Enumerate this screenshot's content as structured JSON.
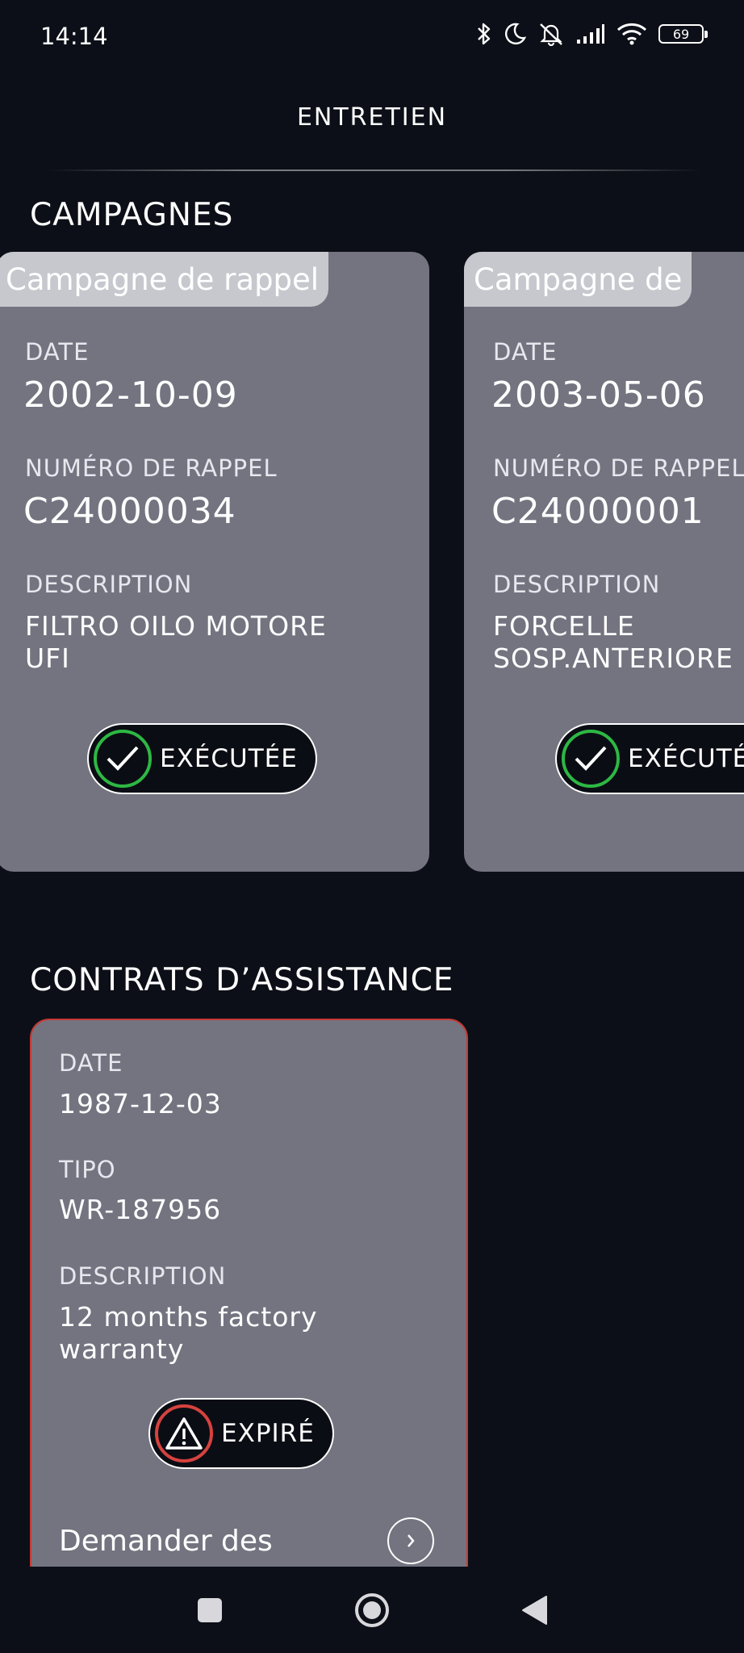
{
  "status_bar": {
    "time": "14:14",
    "battery": "69",
    "icons": [
      "bluetooth-icon",
      "moon-icon",
      "bell-off-icon",
      "signal-icon",
      "wifi-icon",
      "battery-icon"
    ]
  },
  "header": {
    "title": "ENTRETIEN"
  },
  "campaigns": {
    "title": "CAMPAGNES",
    "cards": [
      {
        "type": "Campagne de rappel",
        "date_label": "DATE",
        "date": "2002-10-09",
        "number_label": "NUMÉRO DE RAPPEL",
        "number": "C24000034",
        "description_label": "DESCRIPTION",
        "description_line1": "FILTRO OILO MOTORE",
        "description_line2": "UFI",
        "status": "EXÉCUTÉE"
      },
      {
        "type": "Campagne de",
        "date_label": "DATE",
        "date": "2003-05-06",
        "number_label": "NUMÉRO DE RAPPEL",
        "number": "C24000001",
        "description_label": "DESCRIPTION",
        "description_line1": "FORCELLE",
        "description_line2": "SOSP.ANTERIORE",
        "status": "EXÉCUTÉE"
      }
    ]
  },
  "contracts": {
    "title": "CONTRATS D’ASSISTANCE",
    "card": {
      "date_label": "DATE",
      "date": "1987-12-03",
      "type_label": "TIPO",
      "type": "WR-187956",
      "description_label": "DESCRIPTION",
      "description_line1": "12 months factory",
      "description_line2": "warranty",
      "status": "EXPIRÉ",
      "request_label": "Demander des"
    }
  },
  "colors": {
    "background": "#0c0f17",
    "card": "#737480",
    "tab": "#c7c8ce",
    "ok": "#2db843",
    "warn": "#d6423e"
  }
}
